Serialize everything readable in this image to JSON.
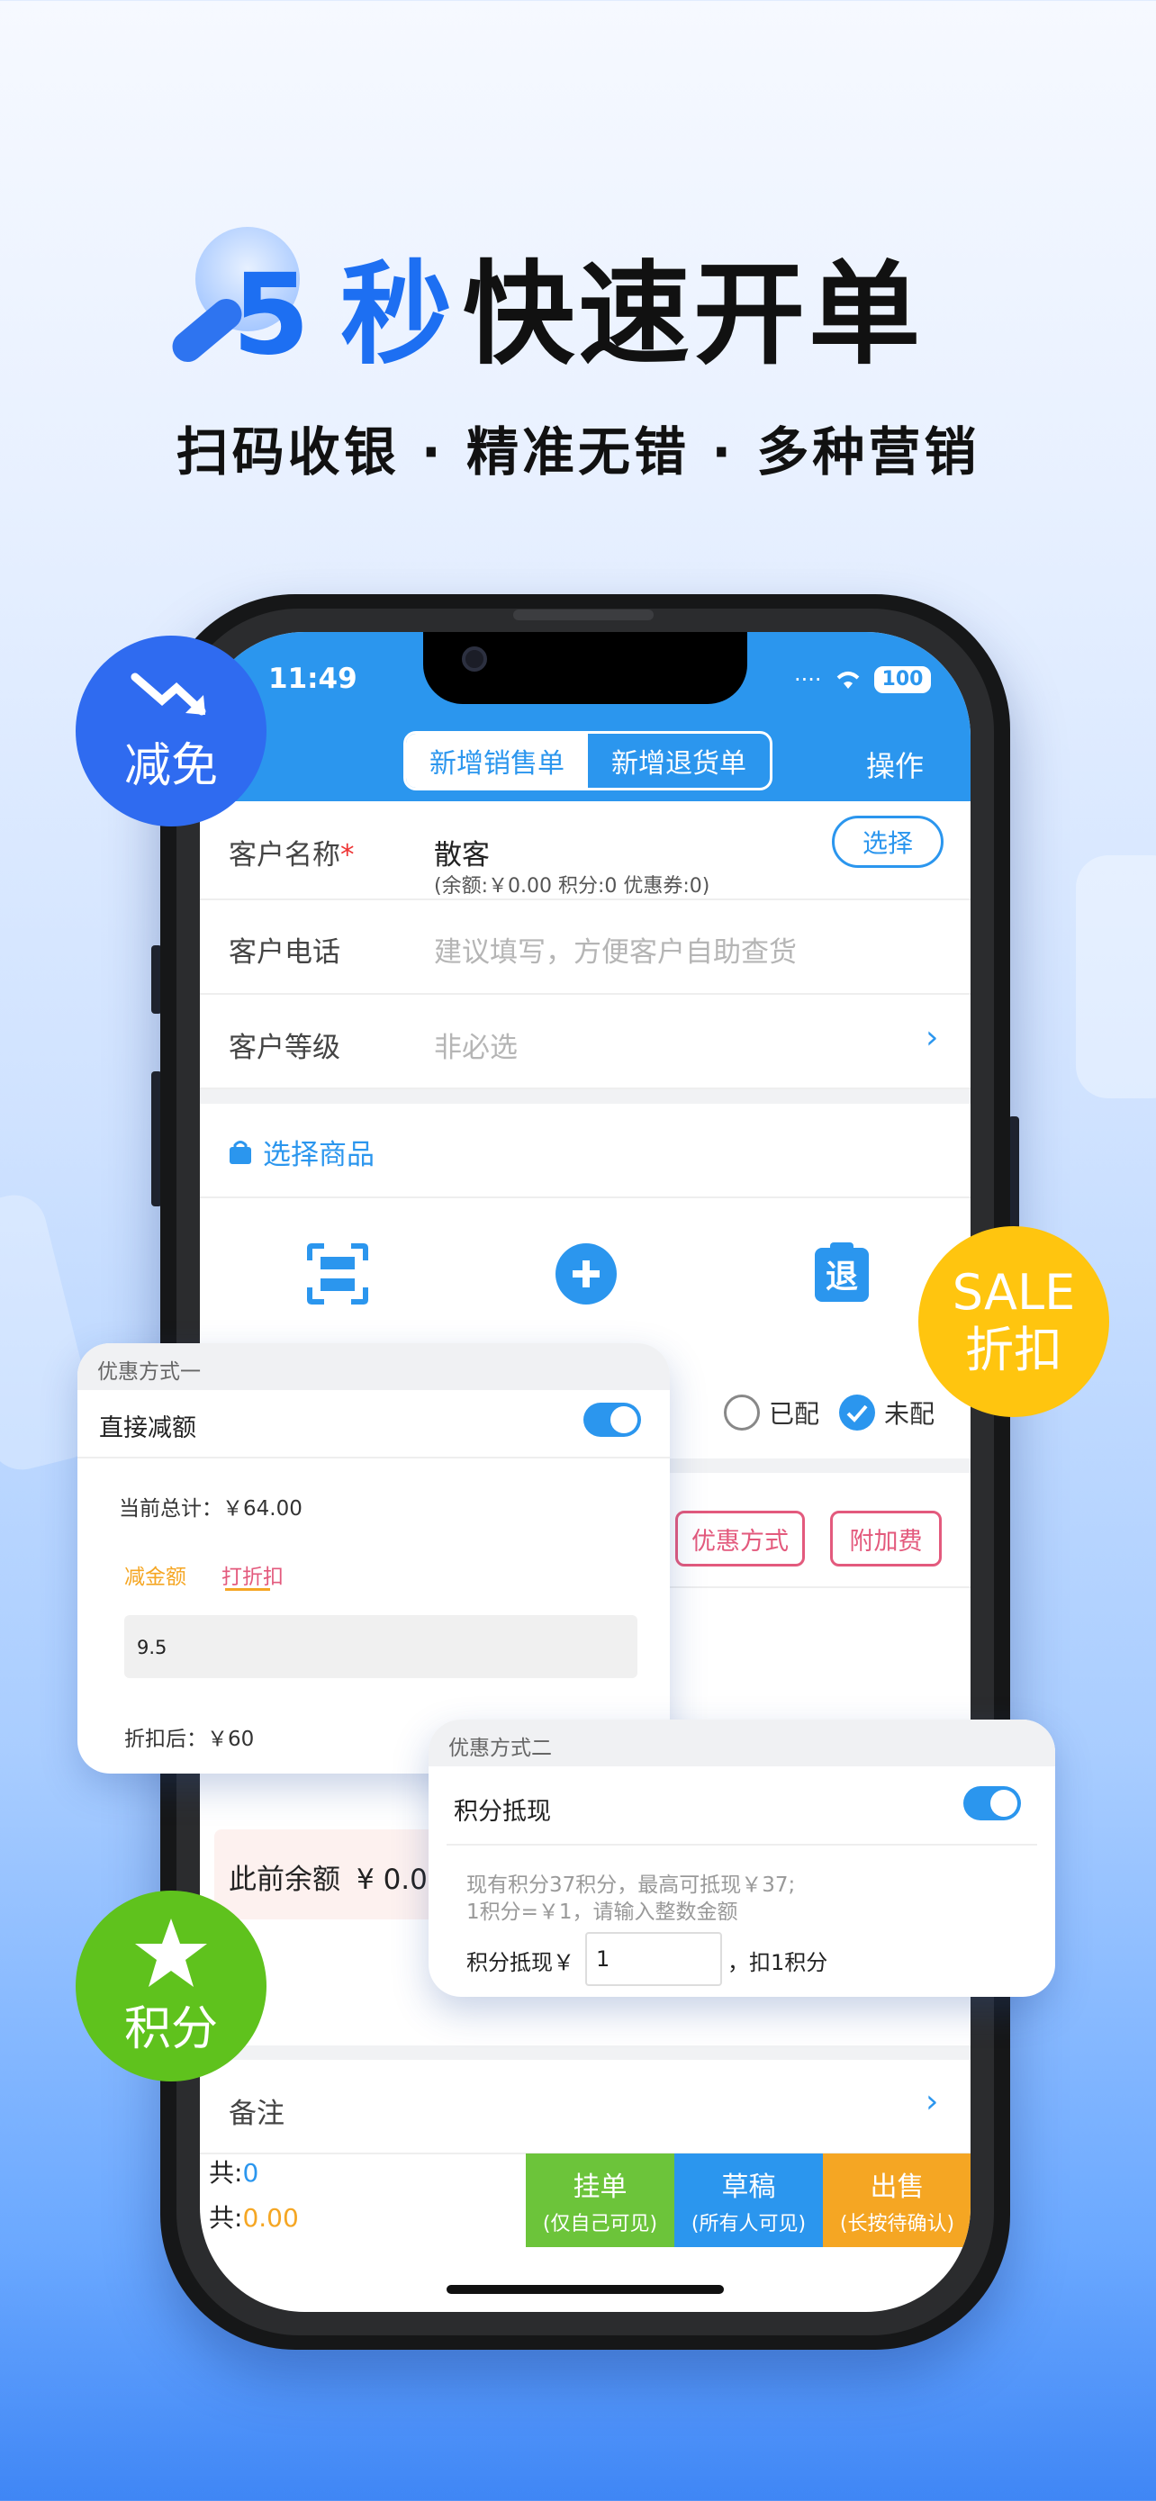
{
  "hero": {
    "num": "5",
    "sec": "秒",
    "rest": "快速开单",
    "subtitle": "扫码收银 · 精准无错 · 多种营销"
  },
  "status": {
    "time": "11:49",
    "battery": "100"
  },
  "header": {
    "tab_sales": "新增销售单",
    "tab_return": "新增退货单",
    "action": "操作"
  },
  "customer": {
    "name_label": "客户名称",
    "required_mark": "*",
    "name_value": "散客",
    "detail": "(余额:￥0.00    积分:0    优惠券:0)",
    "select_button": "选择",
    "phone_label": "客户电话",
    "phone_placeholder": "建议填写，方便客户自助查货",
    "level_label": "客户等级",
    "level_placeholder": "非必选"
  },
  "goods": {
    "title": "选择商品"
  },
  "delivery": {
    "option_delivered": "已配",
    "option_undelivered": "未配"
  },
  "discount_buttons": {
    "discount": "优惠方式",
    "extra_fee": "附加费"
  },
  "balance": {
    "label": "此前余额",
    "value": "¥ 0.00"
  },
  "remark": {
    "label": "备注"
  },
  "footer": {
    "count_label": "共:",
    "count_value": "0",
    "amount_label": "共:",
    "amount_value": "0.00",
    "hold_main": "挂单",
    "hold_sub": "(仅自己可见)",
    "draft_main": "草稿",
    "draft_sub": "(所有人可见)",
    "sell_main": "出售",
    "sell_sub": "(长按待确认)"
  },
  "badges": {
    "reduce": "减免",
    "sale_line1": "SALE",
    "sale_line2": "折扣",
    "points": "积分"
  },
  "card1": {
    "head": "优惠方式一",
    "title": "直接减额",
    "total": "当前总计：￥64.00",
    "tab_reduce": "减金额",
    "tab_discount": "打折扣",
    "input_value": "9.5",
    "after": "折扣后：￥60"
  },
  "card2": {
    "head": "优惠方式二",
    "title": "积分抵现",
    "info_line1": "现有积分37积分，最高可抵现￥37;",
    "info_line2": "1积分=￥1，请输入整数金额",
    "cash_label": "积分抵现￥",
    "cash_value": "1",
    "deduct": "，扣1积分"
  },
  "colors": {
    "brand_blue": "#2b96ee",
    "hero_blue": "#1d6ff2",
    "hold_green": "#6cc43a",
    "draft_blue": "#2b96ee",
    "sell_orange": "#f5a623",
    "badge_blue": "#2f6bf0",
    "badge_yellow": "#ffc50f",
    "badge_green": "#5fc21d",
    "pink": "#e35a7d"
  }
}
